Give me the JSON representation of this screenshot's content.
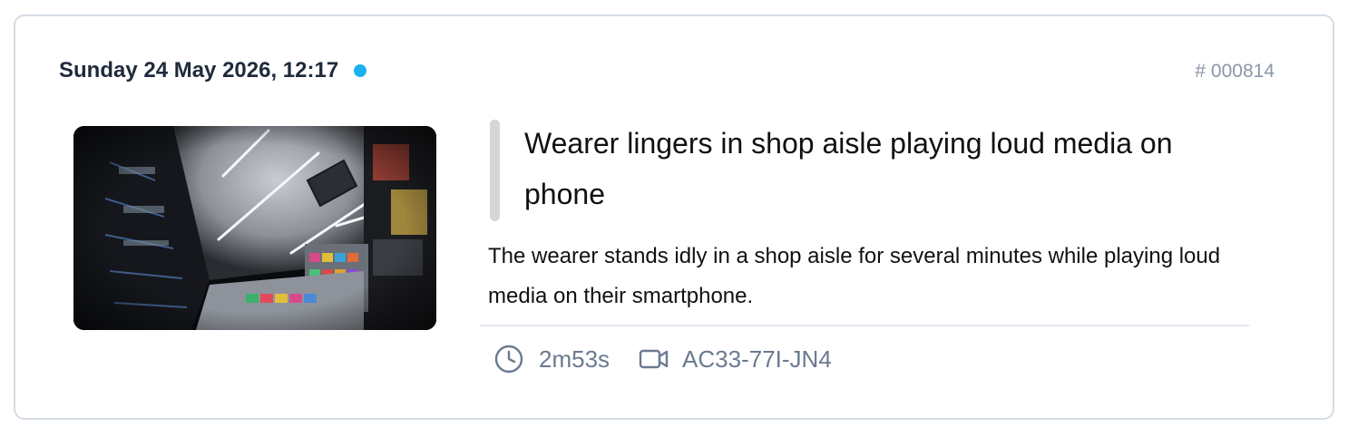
{
  "event": {
    "datetime": "Sunday 24 May 2026, 12:17",
    "status_color": "#1ab2f0",
    "id_label": "# 000814",
    "title": "Wearer lingers in shop aisle playing loud media on phone",
    "description": "The wearer stands idly in a shop aisle for several minutes while playing loud media on their smartphone.",
    "duration": "2m53s",
    "camera_id": "AC33-77I-JN4",
    "thumbnail_alt": "Shop aisle camera thumbnail"
  },
  "icons": {
    "status": "status-dot",
    "duration": "clock-icon",
    "camera": "video-camera-icon"
  },
  "colors": {
    "border": "#d5dce6",
    "meta_text": "#6b7a90",
    "accent_dot": "#1ab2f0"
  }
}
